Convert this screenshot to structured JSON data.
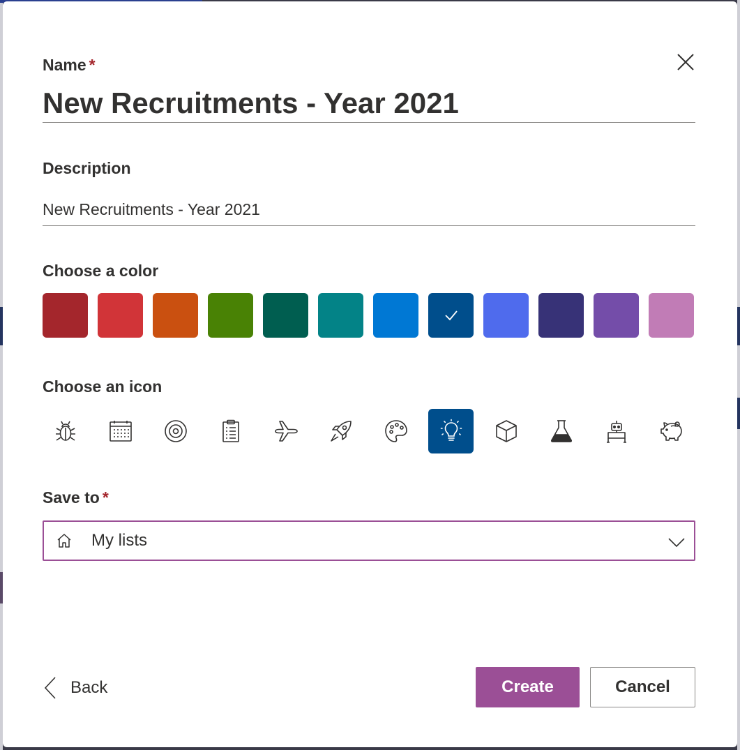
{
  "name": {
    "label": "Name",
    "required": "*",
    "value": "New Recruitments - Year 2021"
  },
  "description": {
    "label": "Description",
    "value": "New Recruitments - Year 2021"
  },
  "color": {
    "label": "Choose a color",
    "selected_index": 7,
    "swatches": [
      "#a4262c",
      "#d13438",
      "#ca5010",
      "#498205",
      "#005e50",
      "#038387",
      "#0078d4",
      "#004e8c",
      "#4f6bed",
      "#373277",
      "#744da9",
      "#c17cb6"
    ]
  },
  "icon": {
    "label": "Choose an icon",
    "selected_index": 7,
    "items": [
      "bug-icon",
      "calendar-icon",
      "target-icon",
      "clipboard-icon",
      "airplane-icon",
      "rocket-icon",
      "palette-icon",
      "lightbulb-icon",
      "cube-icon",
      "flask-icon",
      "robot-icon",
      "piggy-bank-icon"
    ]
  },
  "save_to": {
    "label": "Save to",
    "required": "*",
    "value": "My lists",
    "icon": "home-icon"
  },
  "footer": {
    "back_label": "Back",
    "create_label": "Create",
    "cancel_label": "Cancel"
  },
  "colors": {
    "accent": "#9b4f96",
    "selected_icon_bg": "#004e8c",
    "required_mark": "#a4262c"
  }
}
